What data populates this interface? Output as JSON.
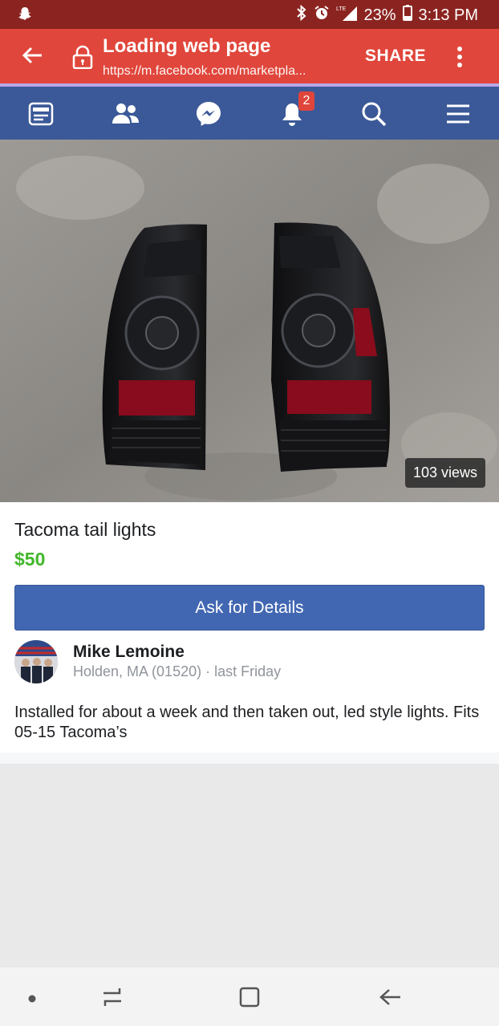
{
  "status_bar": {
    "battery": "23%",
    "time": "3:13 PM"
  },
  "browser": {
    "title": "Loading web page",
    "url": "https://m.facebook.com/marketpla...",
    "share_label": "SHARE"
  },
  "fb_nav": {
    "notification_count": "2"
  },
  "listing": {
    "views": "103 views",
    "title": "Tacoma tail lights",
    "price": "$50",
    "ask_button": "Ask for Details",
    "seller_name": "Mike Lemoine",
    "location": "Holden, MA (01520) · last Friday",
    "description": "Installed for about a week and then taken out, led style lights. Fits 05-15 Tacoma’s"
  },
  "colors": {
    "status_bar": "#8b2420",
    "app_bar": "#e0463b",
    "fb_blue": "#3b5998",
    "button_blue": "#4267b2",
    "price_green": "#42b72a"
  }
}
